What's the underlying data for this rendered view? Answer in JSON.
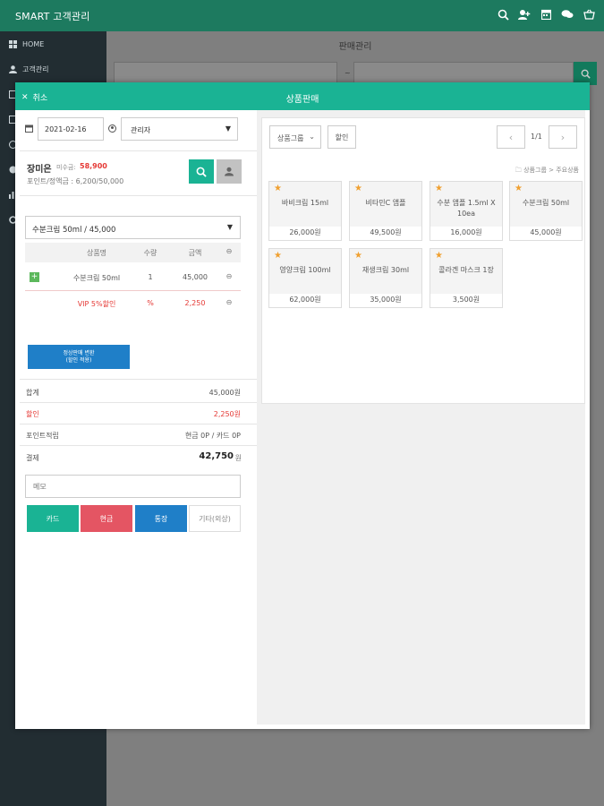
{
  "topbar": {
    "brand": "SMART 고객관리",
    "icons": [
      "search-icon",
      "add-user-icon",
      "calendar-icon",
      "chat-icon",
      "basket-icon"
    ]
  },
  "sidebar": {
    "items": [
      {
        "icon": "grid-icon",
        "label": "HOME"
      },
      {
        "icon": "user-icon",
        "label": "고객관리"
      },
      {
        "icon": "calendar-icon",
        "label": ""
      },
      {
        "icon": "calendar-icon",
        "label": ""
      },
      {
        "icon": "clock-icon",
        "label": ""
      },
      {
        "icon": "dollar-icon",
        "label": ""
      },
      {
        "icon": "chart-icon",
        "label": ""
      },
      {
        "icon": "settings-icon",
        "label": ""
      }
    ]
  },
  "main": {
    "title": "판매관리",
    "date_sep": "~"
  },
  "modal": {
    "close_label": "취소",
    "title": "상품판매",
    "date": "2021-02-16",
    "staff": "관리자",
    "customer": {
      "name": "장미은",
      "unpaid_label": "미수금:",
      "unpaid_value": "58,900",
      "points": "포인트/정액금 : 6,200/50,000"
    },
    "product_select": "수분크림 50ml / 45,000",
    "table": {
      "headers": [
        "상품명",
        "수량",
        "금액"
      ],
      "rows": [
        {
          "name": "수분크림 50ml",
          "qty": "1",
          "amount": "45,000"
        },
        {
          "name": "VIP 5%할인",
          "qty": "%",
          "amount": "2,250"
        }
      ]
    },
    "apply_button": "정상판매 변환\n(할인 적용)",
    "summary": {
      "total_label": "합계",
      "total_value": "45,000원",
      "discount_label": "할인",
      "discount_value": "2,250원",
      "points_label": "포인트적립",
      "points_value": "현금 0P / 카드 0P",
      "pay_label": "결제",
      "pay_value": "42,750",
      "pay_unit": "원"
    },
    "memo_placeholder": "메모",
    "pay_buttons": {
      "card": "카드",
      "cash": "현금",
      "bank": "통장",
      "other": "기타(외상)"
    },
    "product_group_select": "상품그룹",
    "discount_button": "할인",
    "pager": "1/1",
    "breadcrumb": "상품그룹 > 주요상품",
    "products": [
      {
        "name": "바비크림 15ml",
        "price": "26,000원"
      },
      {
        "name": "비타민C 앰플",
        "price": "49,500원"
      },
      {
        "name": "수분 앰플 1.5ml X 10ea",
        "price": "16,000원"
      },
      {
        "name": "수분크림 50ml",
        "price": "45,000원"
      },
      {
        "name": "영양크림 100ml",
        "price": "62,000원"
      },
      {
        "name": "재생크림 30ml",
        "price": "35,000원"
      },
      {
        "name": "콜라겐 마스크 1장",
        "price": "3,500원"
      }
    ]
  },
  "colors": {
    "topbar": "#1d7a5f",
    "accent": "#1ab394",
    "discount": "#e53935",
    "cash": "#e45563",
    "bank": "#1f7fc8",
    "sidebar": "#222d32"
  }
}
